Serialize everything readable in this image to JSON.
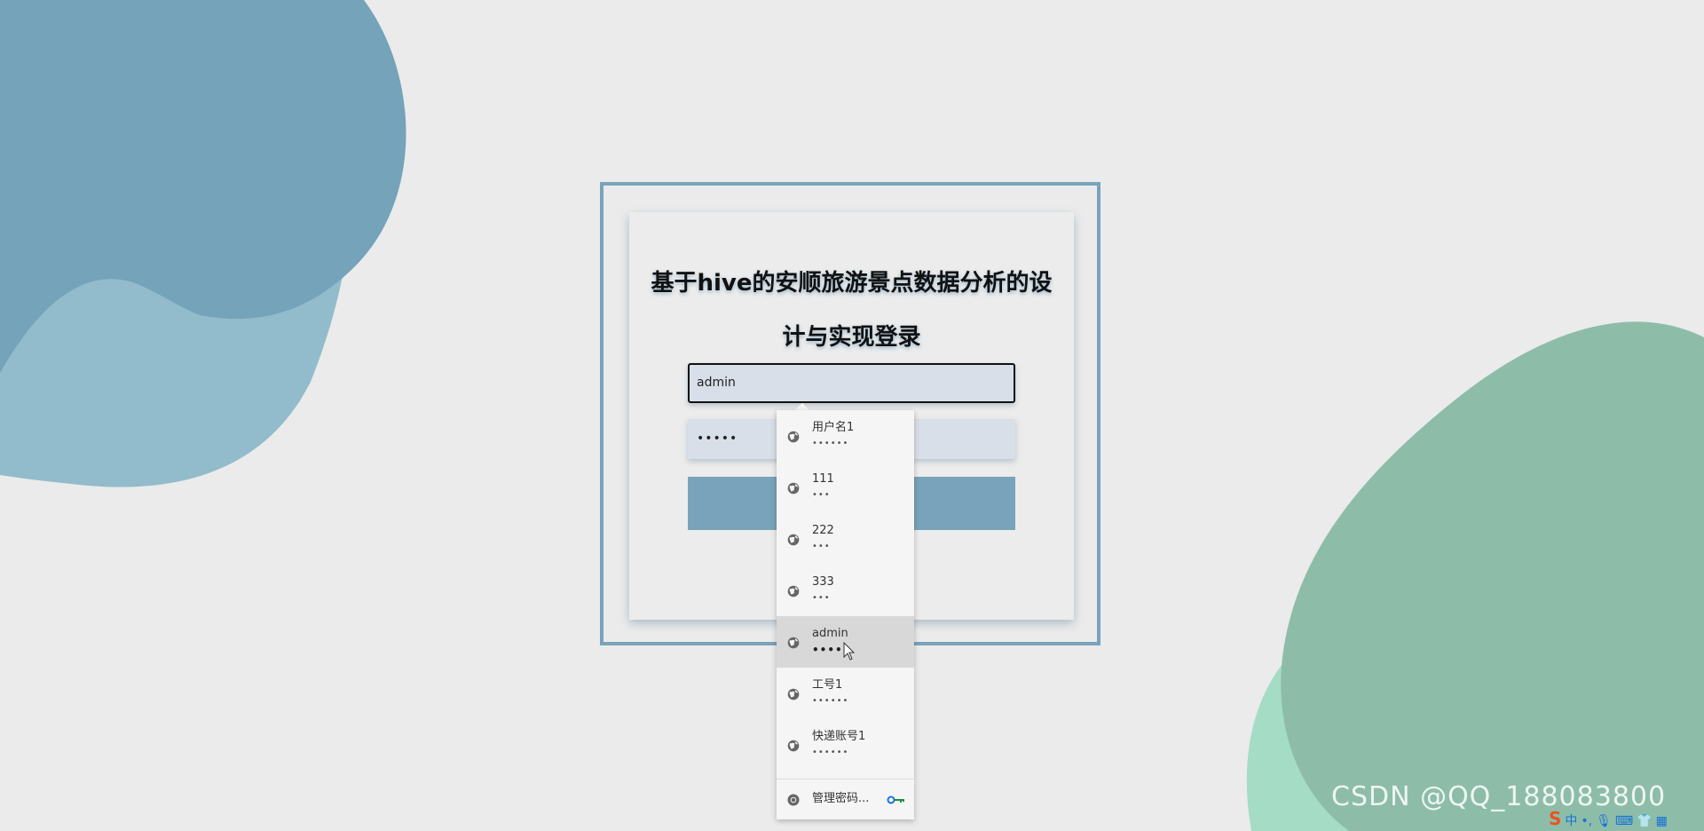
{
  "page": {
    "title_line1": "基于hive的安顺旅游景点数据分析的设",
    "title_line2": "计与实现登录"
  },
  "login_form": {
    "username_value": "admin",
    "password_value": "•••••",
    "login_button_label": ""
  },
  "autofill_dropdown": {
    "items": [
      {
        "name": "用户名1",
        "masked_password": "••••••"
      },
      {
        "name": "111",
        "masked_password": "•••"
      },
      {
        "name": "222",
        "masked_password": "•••"
      },
      {
        "name": "333",
        "masked_password": "•••"
      },
      {
        "name": "admin",
        "masked_password": "•••••",
        "active": true
      },
      {
        "name": "工号1",
        "masked_password": "••••••"
      },
      {
        "name": "快递账号1",
        "masked_password": "••••••"
      }
    ],
    "manage_label": "管理密码..."
  },
  "watermark": {
    "text": "CSDN @QQ_188083800"
  },
  "ime_bar": {
    "logo": "S",
    "mode": "中",
    "punct": "•,"
  },
  "colors": {
    "background": "#ebebeb",
    "accent_blue": "#79a3ba",
    "blob_blue_dark": "#74a3ba",
    "blob_blue_light": "#92bccb",
    "blob_green": "#8dbda9",
    "blob_mint": "#a4dcc6",
    "field_bg": "#d9dfe9"
  },
  "icons": {
    "item_icon": "globe-icon",
    "manage_icon": "chrome-icon",
    "key_icon": "key-icon"
  }
}
